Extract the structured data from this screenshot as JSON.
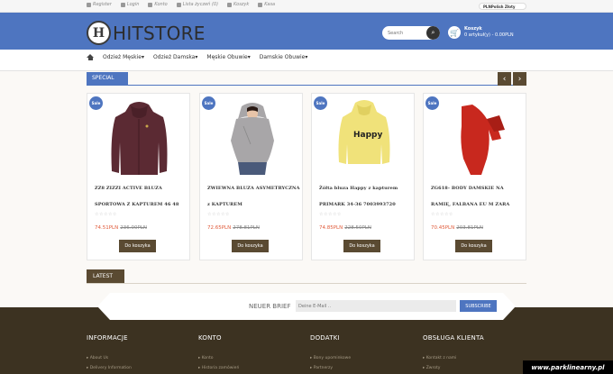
{
  "topbar": {
    "links": [
      {
        "label": "Register",
        "icon": "pencil-icon"
      },
      {
        "label": "Login",
        "icon": "lock-icon"
      },
      {
        "label": "Konto",
        "icon": "user-icon"
      },
      {
        "label": "Lista życzeń (0)",
        "icon": "list-icon"
      },
      {
        "label": "Koszyk",
        "icon": "cart-icon"
      },
      {
        "label": "Kasa",
        "icon": "share-icon"
      }
    ],
    "lang_currency": "PLNPolish Złoty"
  },
  "header": {
    "logo_mark": "H",
    "logo_text": "HITSTORE",
    "search_placeholder": "Search",
    "cart_title": "Koszyk",
    "cart_summary": "0 artykuł(y) - 0.00PLN"
  },
  "nav": {
    "items": [
      "Odzież Męskie",
      "Odzież Damska",
      "Męskie Obuwie",
      "Damskie Obuwie"
    ]
  },
  "special": {
    "title": "SPECIAL",
    "products": [
      {
        "badge": "Sale",
        "name": "ZZ8 ZIZZI ACTIVE BLUZA SPORTOWA Z KAPTUREM 46 48",
        "price_new": "74.51PLN",
        "price_old": "236.00PLN",
        "button": "Do koszyka",
        "color": "#5b2a33"
      },
      {
        "badge": "Sale",
        "name": "ZWIEWNA BLUZA ASYMETRYCZNA z KAPTUREM",
        "price_new": "72.65PLN",
        "price_old": "278.81PLN",
        "button": "Do koszyka",
        "color": "#a8a6a8"
      },
      {
        "badge": "Sale",
        "name": "Żółta bluza Happy z kapturem PRIMARK 34-36 7003993720",
        "price_new": "74.85PLN",
        "price_old": "228.50PLN",
        "button": "Do koszyka",
        "color": "#f0e27a"
      },
      {
        "badge": "Sale",
        "name": "ZG618- BODY DAMSKIE NA RAMIĘ, FALBANA EU M ZARA",
        "price_new": "70.45PLN",
        "price_old": "203.81PLN",
        "button": "Do koszyka",
        "color": "#c8281e"
      }
    ],
    "stars": "☆☆☆☆☆"
  },
  "latest": {
    "title": "LATEST"
  },
  "newsletter": {
    "label": "NEUER BRIEF",
    "placeholder": "Deine E-Mail ..",
    "button": "SUBSCRIBE"
  },
  "footer": {
    "columns": [
      {
        "title": "INFORMACJE",
        "items": [
          "About Us",
          "Delivery Information"
        ]
      },
      {
        "title": "KONTO",
        "items": [
          "Konto",
          "Historia zamówień"
        ]
      },
      {
        "title": "DODATKI",
        "items": [
          "Bony upominkowe",
          "Partnerzy"
        ]
      },
      {
        "title": "OBSŁUGA KLIENTA",
        "items": [
          "Kontakt z nami",
          "Zwroty"
        ]
      }
    ]
  },
  "watermark": "www.parklinearny.pl",
  "colors": {
    "accent": "#4e75c0",
    "brown": "#5a4a32",
    "footer": "#3c3221",
    "sale_price": "#e05a3a"
  }
}
